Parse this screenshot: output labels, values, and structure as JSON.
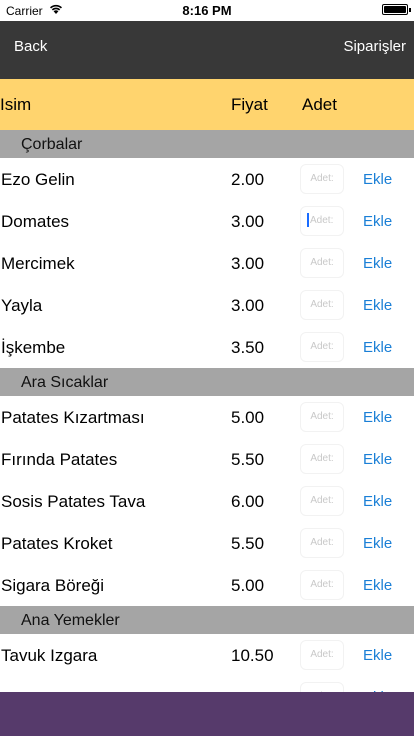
{
  "status": {
    "carrier": "Carrier",
    "time": "8:16 PM"
  },
  "nav": {
    "back_label": "Back",
    "orders_label": "Siparişler"
  },
  "header": {
    "name": "Isim",
    "price": "Fiyat",
    "qty": "Adet"
  },
  "qty_placeholder": "Adet:",
  "add_label": "Ekle",
  "sections": [
    {
      "title": "Çorbalar",
      "items": [
        {
          "name": "Ezo Gelin",
          "price": "2.00"
        },
        {
          "name": "Domates",
          "price": "3.00"
        },
        {
          "name": "Mercimek",
          "price": "3.00"
        },
        {
          "name": "Yayla",
          "price": "3.00"
        },
        {
          "name": "İşkembe",
          "price": "3.50"
        }
      ]
    },
    {
      "title": "Ara Sıcaklar",
      "items": [
        {
          "name": "Patates Kızartması",
          "price": "5.00"
        },
        {
          "name": "Fırında Patates",
          "price": "5.50"
        },
        {
          "name": "Sosis Patates Tava",
          "price": "6.00"
        },
        {
          "name": "Patates Kroket",
          "price": "5.50"
        },
        {
          "name": "Sigara Böreği",
          "price": "5.00"
        }
      ]
    },
    {
      "title": "Ana Yemekler",
      "items": [
        {
          "name": "Tavuk Izgara",
          "price": "10.50"
        },
        {
          "name": "",
          "price": ""
        }
      ]
    }
  ],
  "colors": {
    "nav_bg": "#383838",
    "header_bg": "#ffd46e",
    "section_bg": "#a5a5a5",
    "link": "#1a7fd6",
    "bottom_bar": "#563a6b"
  }
}
